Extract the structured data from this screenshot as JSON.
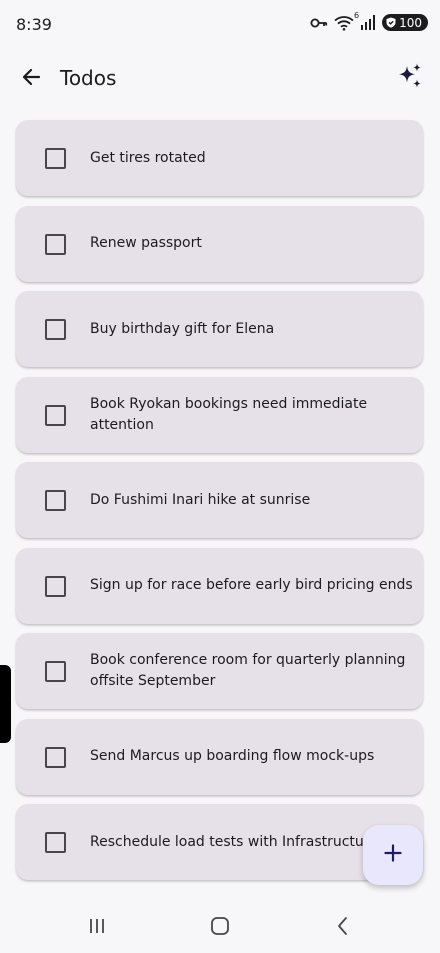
{
  "status_bar": {
    "time": "8:39",
    "battery": "100",
    "icons": [
      "key-icon",
      "wifi-icon",
      "signal-icon",
      "battery-icon"
    ],
    "wifi_badge": "6"
  },
  "app_bar": {
    "title": "Todos",
    "back_icon": "arrow-back-icon",
    "action_icon": "sparkle-icon"
  },
  "todos": [
    {
      "text": "Get tires rotated",
      "checked": false
    },
    {
      "text": "Renew passport",
      "checked": false
    },
    {
      "text": "Buy birthday gift for Elena",
      "checked": false
    },
    {
      "text": "Book Ryokan bookings need immediate attention",
      "checked": false
    },
    {
      "text": "Do Fushimi Inari hike at sunrise",
      "checked": false
    },
    {
      "text": "Sign up for race before early bird pricing ends",
      "checked": false
    },
    {
      "text": "Book conference room for quarterly planning offsite September",
      "checked": false
    },
    {
      "text": "Send Marcus up boarding flow mock-ups",
      "checked": false
    },
    {
      "text": "Reschedule load tests with Infrastructure Team before Thursday",
      "checked": false
    }
  ],
  "fab": {
    "icon": "plus-icon"
  },
  "nav_bar": {
    "icons": [
      "recents-icon",
      "home-icon",
      "back-nav-icon"
    ]
  },
  "colors": {
    "background": "#f7f6f8",
    "card": "#e6e0e8",
    "text": "#1c1b1f",
    "checkbox_border": "#49454f",
    "fab_background": "#e9e7fb",
    "fab_icon": "#1d1a6b"
  }
}
